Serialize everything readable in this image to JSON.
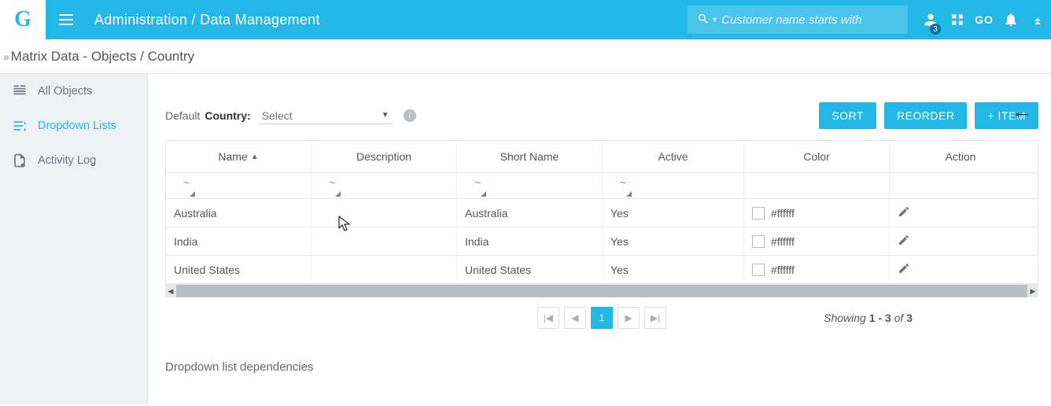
{
  "topbar": {
    "breadcrumb": "Administration / Data Management",
    "search_placeholder": "Customer name starts with",
    "badge_count": "3",
    "go_label": "GO"
  },
  "page_title": "Matrix Data - Objects / Country",
  "sidebar": {
    "items": [
      {
        "label": "All Objects"
      },
      {
        "label": "Dropdown Lists"
      },
      {
        "label": "Activity Log"
      }
    ]
  },
  "default_select": {
    "prefix": "Default",
    "bold": "Country",
    "value": "Select"
  },
  "buttons": {
    "sort": "SORT",
    "reorder": "REORDER",
    "add": "+ ITEM"
  },
  "table": {
    "headers": {
      "name": "Name",
      "description": "Description",
      "short_name": "Short Name",
      "active": "Active",
      "color": "Color",
      "action": "Action"
    },
    "rows": [
      {
        "name": "Australia",
        "description": "",
        "short_name": "Australia",
        "active": "Yes",
        "color": "#ffffff"
      },
      {
        "name": "India",
        "description": "",
        "short_name": "India",
        "active": "Yes",
        "color": "#ffffff"
      },
      {
        "name": "United States",
        "description": "",
        "short_name": "United States",
        "active": "Yes",
        "color": "#ffffff"
      }
    ]
  },
  "pagination": {
    "current": "1",
    "summary_prefix": "Showing",
    "summary_range": "1 - 3",
    "summary_mid": "of",
    "summary_total": "3"
  },
  "deps_heading": "Dropdown list dependencies"
}
